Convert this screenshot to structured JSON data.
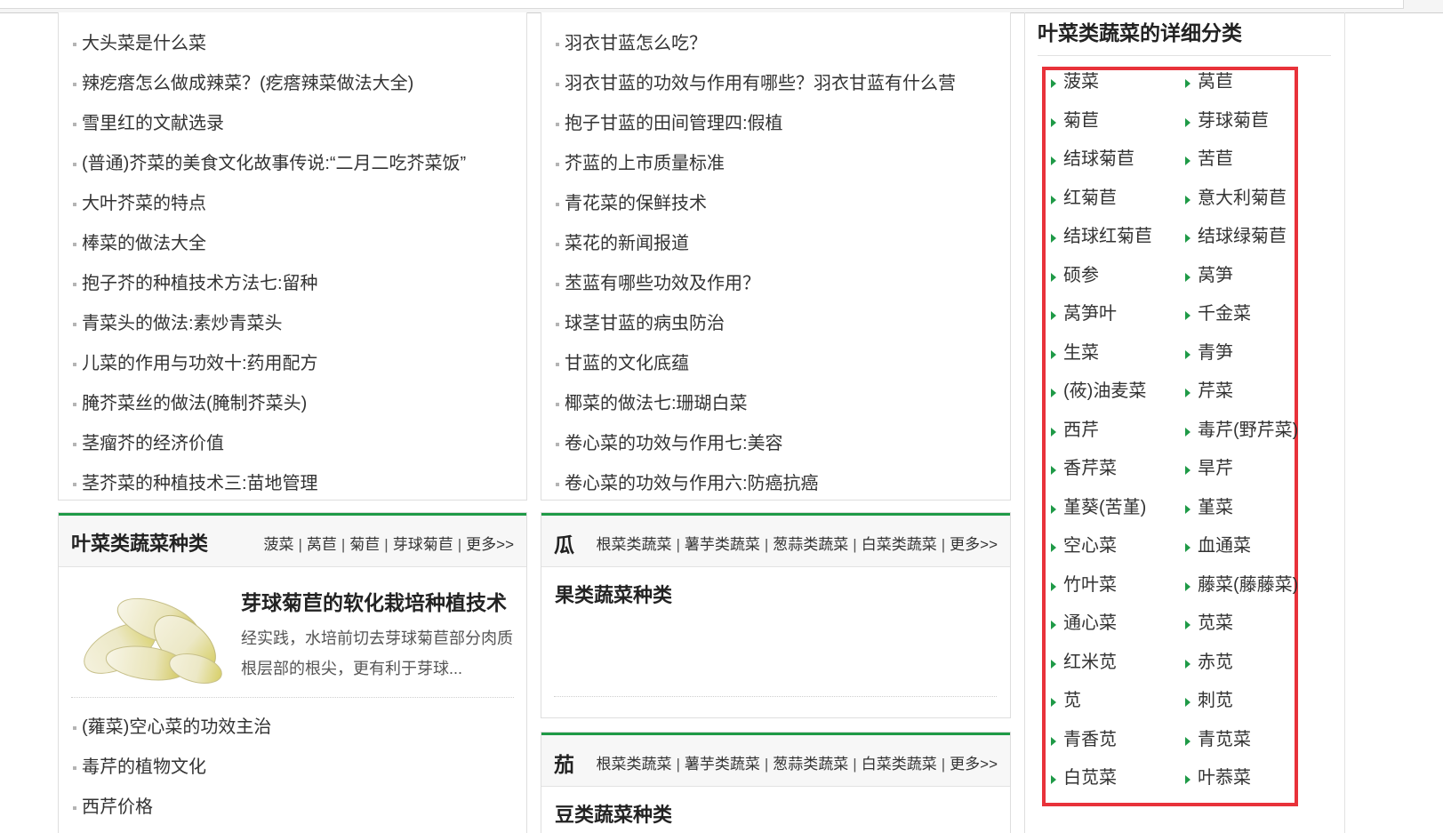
{
  "left_list": [
    "大头菜是什么菜",
    "辣疙瘩怎么做成辣菜？(疙瘩辣菜做法大全)",
    "雪里红的文献选录",
    "(普通)芥菜的美食文化故事传说:“二月二吃芥菜饭”",
    "大叶芥菜的特点",
    "棒菜的做法大全",
    "抱子芥的种植技术方法七:留种",
    "青菜头的做法:素炒青菜头",
    "儿菜的作用与功效十:药用配方",
    "腌芥菜丝的做法(腌制芥菜头)",
    "茎瘤芥的经济价值",
    "茎芥菜的种植技术三:苗地管理"
  ],
  "middle_list": [
    "羽衣甘蓝怎么吃？",
    "羽衣甘蓝的功效与作用有哪些？羽衣甘蓝有什么营",
    "抱子甘蓝的田间管理四:假植",
    "芥蓝的上市质量标准",
    "青花菜的保鲜技术",
    "菜花的新闻报道",
    "苤蓝有哪些功效及作用？",
    "球茎甘蓝的病虫防治",
    "甘蓝的文化底蕴",
    "椰菜的做法七:珊瑚白菜",
    "卷心菜的功效与作用七:美容",
    "卷心菜的功效与作用六:防癌抗癌"
  ],
  "leafy_section": {
    "title": "叶菜类蔬菜种类",
    "links": [
      "菠菜",
      "莴苣",
      "菊苣",
      "芽球菊苣",
      "更多>>"
    ],
    "feature_title": "芽球菊苣的软化栽培种植技术",
    "feature_desc": "经实践，水培前切去芽球菊苣部分肉质根层部的根尖，更有利于芽球...",
    "list": [
      "(蕹菜)空心菜的功效主治",
      "毒芹的植物文化",
      "西芹价格"
    ]
  },
  "melon_section": {
    "icon": "瓜",
    "links": [
      "根菜类蔬菜",
      "薯芋类蔬菜",
      "葱蒜类蔬菜",
      "白菜类蔬菜",
      "更多>>"
    ],
    "subtitle": "果类蔬菜种类"
  },
  "eggplant_section": {
    "icon": "茄",
    "links": [
      "根菜类蔬菜",
      "薯芋类蔬菜",
      "葱蒜类蔬菜",
      "白菜类蔬菜",
      "更多>>"
    ],
    "subtitle": "豆类蔬菜种类"
  },
  "sidebar": {
    "title": "叶菜类蔬菜的详细分类",
    "categories": [
      "菠菜",
      "莴苣",
      "菊苣",
      "芽球菊苣",
      "结球菊苣",
      "苦苣",
      "红菊苣",
      "意大利菊苣",
      "结球红菊苣",
      "结球绿菊苣",
      "硕参",
      "莴笋",
      "莴笋叶",
      "千金菜",
      "生菜",
      "青笋",
      "(莜)油麦菜",
      "芹菜",
      "西芹",
      "毒芹(野芹菜)",
      "香芹菜",
      "旱芹",
      "堇葵(苦堇)",
      "堇菜",
      "空心菜",
      "血通菜",
      "竹叶菜",
      "藤菜(藤藤菜)",
      "通心菜",
      "苋菜",
      "红米苋",
      "赤苋",
      "苋",
      "刺苋",
      "青香苋",
      "青苋菜",
      "白苋菜",
      "叶菾菜"
    ]
  },
  "colors": {
    "accent_green": "#1f9a47",
    "highlight_red": "#e8323a"
  }
}
